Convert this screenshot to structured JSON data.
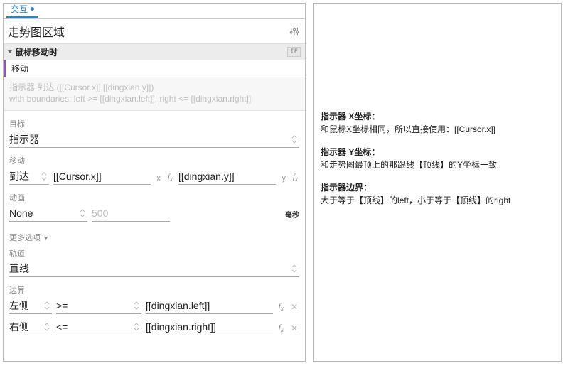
{
  "tab": {
    "label": "交互"
  },
  "title": "走势图区域",
  "event": {
    "label": "鼠标移动时",
    "if_label": "IF"
  },
  "action": {
    "label": "移动",
    "desc_l1": "指示器 到达 ([[Cursor.x]],[[dingxian.y]])",
    "desc_l2": "with boundaries: left >= [[dingxian.left]], right <= [[dingxian.right]]"
  },
  "labels": {
    "target": "目标",
    "move": "移动",
    "anim": "动画",
    "more": "更多选项",
    "track": "轨道",
    "bounds": "边界"
  },
  "target": "指示器",
  "move": {
    "type": "到达",
    "x": "[[Cursor.x]]",
    "y": "[[dingxian.y]]"
  },
  "anim": {
    "easing": "None",
    "duration_placeholder": "500",
    "unit": "毫秒"
  },
  "track": "直线",
  "bounds": {
    "left": {
      "side": "左侧",
      "op": ">=",
      "expr": "[[dingxian.left]]"
    },
    "right": {
      "side": "右侧",
      "op": "<=",
      "expr": "[[dingxian.right]]"
    }
  },
  "notes": {
    "t1": "指示器 X坐标：",
    "l1": "和鼠标X坐标相同，所以直接使用：[[Cursor.x]]",
    "t2": "指示器 Y坐标：",
    "l2": "和走势图最顶上的那跟线【顶线】的Y坐标一致",
    "t3": "指示器边界：",
    "l3": "大于等于【顶线】的left，小于等于【顶线】的right"
  }
}
